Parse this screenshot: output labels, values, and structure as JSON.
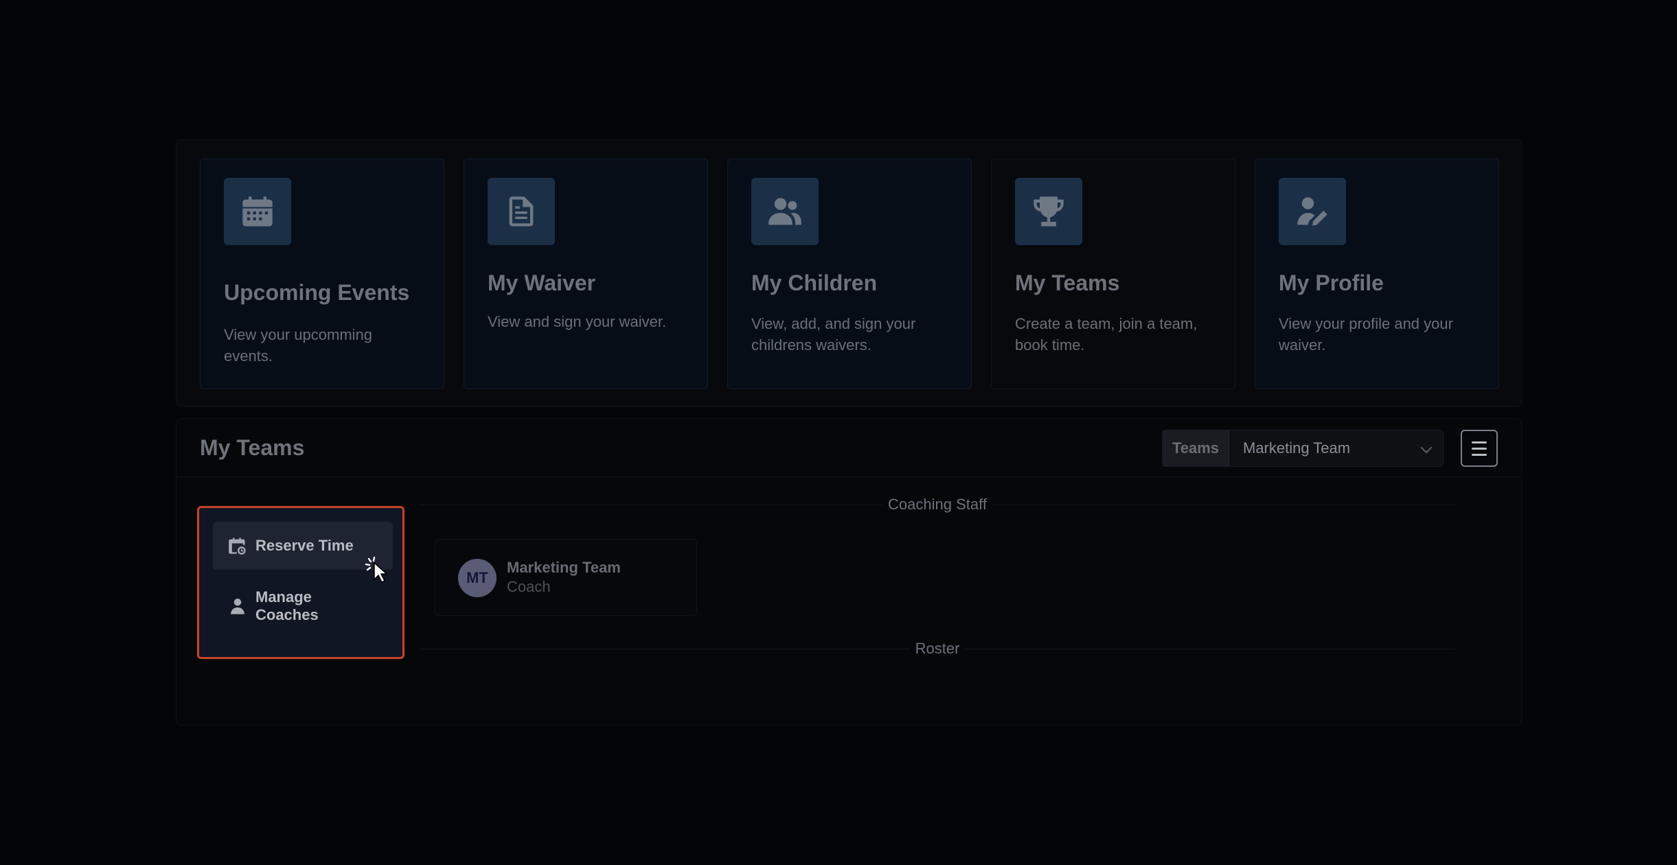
{
  "cards": [
    {
      "title": "Upcoming Events",
      "description": "View your upcomming events.",
      "icon": "calendar-icon"
    },
    {
      "title": "My Waiver",
      "description": "View and sign your waiver.",
      "icon": "document-icon"
    },
    {
      "title": "My Children",
      "description": "View, add, and sign your childrens waivers.",
      "icon": "users-icon"
    },
    {
      "title": "My Teams",
      "description": "Create a team, join a team, book time.",
      "icon": "trophy-icon"
    },
    {
      "title": "My Profile",
      "description": "View your profile and your waiver.",
      "icon": "user-edit-icon"
    }
  ],
  "teams_panel": {
    "title": "My Teams",
    "select_label": "Teams",
    "select_value": "Marketing Team"
  },
  "menu": {
    "items": [
      {
        "label": "Reserve Time",
        "icon": "calendar-clock-icon"
      },
      {
        "label": "Manage Coaches",
        "icon": "person-icon"
      }
    ]
  },
  "sections": {
    "coaching_staff": "Coaching Staff",
    "roster": "Roster"
  },
  "coach": {
    "initials": "MT",
    "name": "Marketing Team",
    "role": "Coach"
  },
  "colors": {
    "highlight_border": "#c9412a",
    "icon_box": "#1b2f47",
    "avatar": "#5a5b75"
  }
}
